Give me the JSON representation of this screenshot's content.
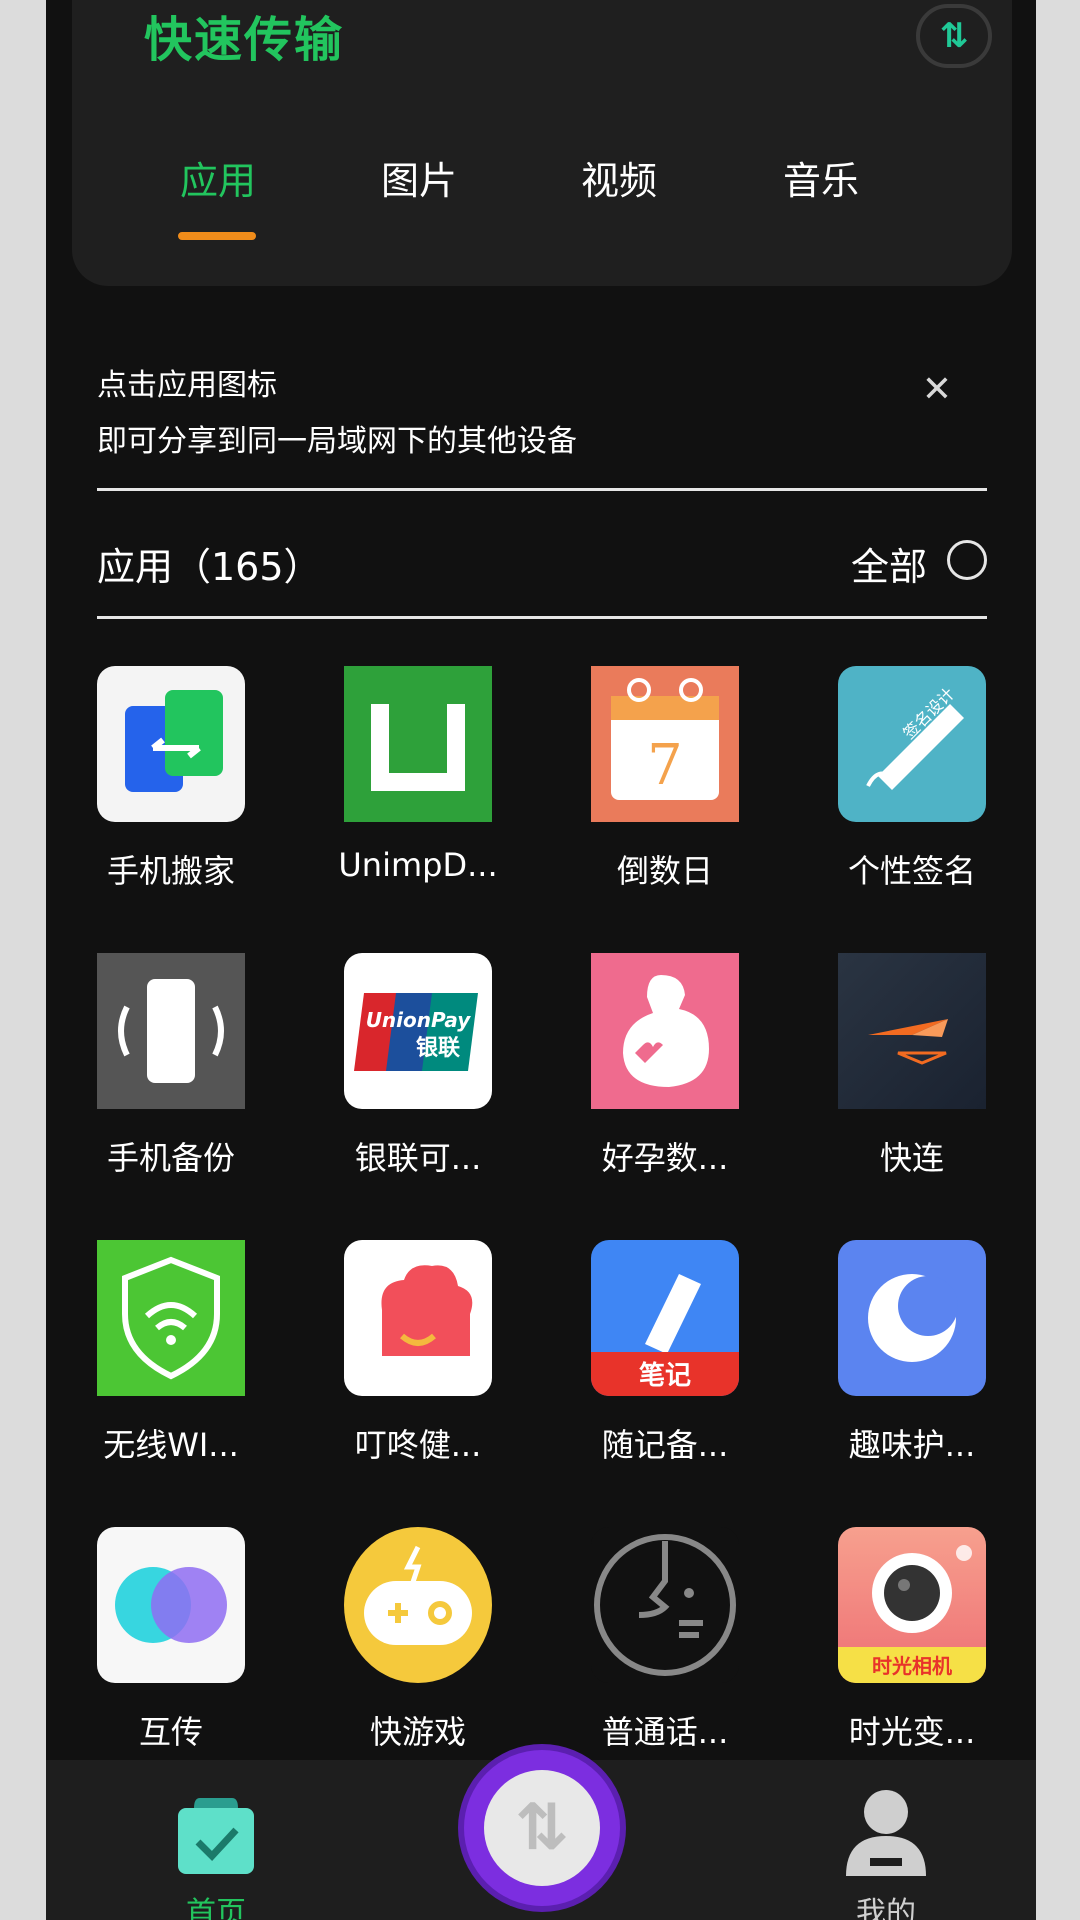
{
  "header": {
    "title": "快速传输",
    "cloud_icon": "transfer-cloud-icon",
    "tabs": [
      {
        "label": "应用",
        "active": true
      },
      {
        "label": "图片",
        "active": false
      },
      {
        "label": "视频",
        "active": false
      },
      {
        "label": "音乐",
        "active": false
      }
    ]
  },
  "hint": {
    "line1": "点击应用图标",
    "line2": "即可分享到同一局域网下的其他设备",
    "close_icon": "close-icon"
  },
  "section": {
    "title": "应用（165）",
    "all_label": "全部",
    "all_selected": false
  },
  "apps": [
    {
      "label": "手机搬家",
      "icon": "phone-clone-icon"
    },
    {
      "label": "UnimpD...",
      "icon": "unimp-icon"
    },
    {
      "label": "倒数日",
      "icon": "countdown-calendar-icon"
    },
    {
      "label": "个性签名",
      "icon": "signature-pen-icon"
    },
    {
      "label": "手机备份",
      "icon": "phone-backup-icon"
    },
    {
      "label": "银联可...",
      "icon": "unionpay-icon"
    },
    {
      "label": "好孕数...",
      "icon": "pregnancy-icon"
    },
    {
      "label": "快连",
      "icon": "quick-connect-icon"
    },
    {
      "label": "无线WI...",
      "icon": "wifi-shield-icon"
    },
    {
      "label": "叮咚健...",
      "icon": "chef-hat-icon"
    },
    {
      "label": "随记备...",
      "icon": "notes-pen-icon"
    },
    {
      "label": "趣味护...",
      "icon": "moon-icon"
    },
    {
      "label": "互传",
      "icon": "mutual-transfer-icon"
    },
    {
      "label": "快游戏",
      "icon": "gamepad-icon"
    },
    {
      "label": "普通话...",
      "icon": "mandarin-face-icon"
    },
    {
      "label": "时光变...",
      "icon": "camera-icon"
    }
  ],
  "icon_texts": {
    "unionpay": "UnionPay",
    "unionpay_cn": "银联",
    "notes": "笔记",
    "camera": "时光相机",
    "signature": "签名设计",
    "countdown_digit": "7"
  },
  "bottom_nav": {
    "home_label": "首页",
    "mine_label": "我的",
    "transfer_icon": "transfer-arrows-icon"
  },
  "colors": {
    "accent_green": "#22c55e",
    "tab_underline": "#f08c1a",
    "transfer_purple": "#7c2ee0"
  }
}
